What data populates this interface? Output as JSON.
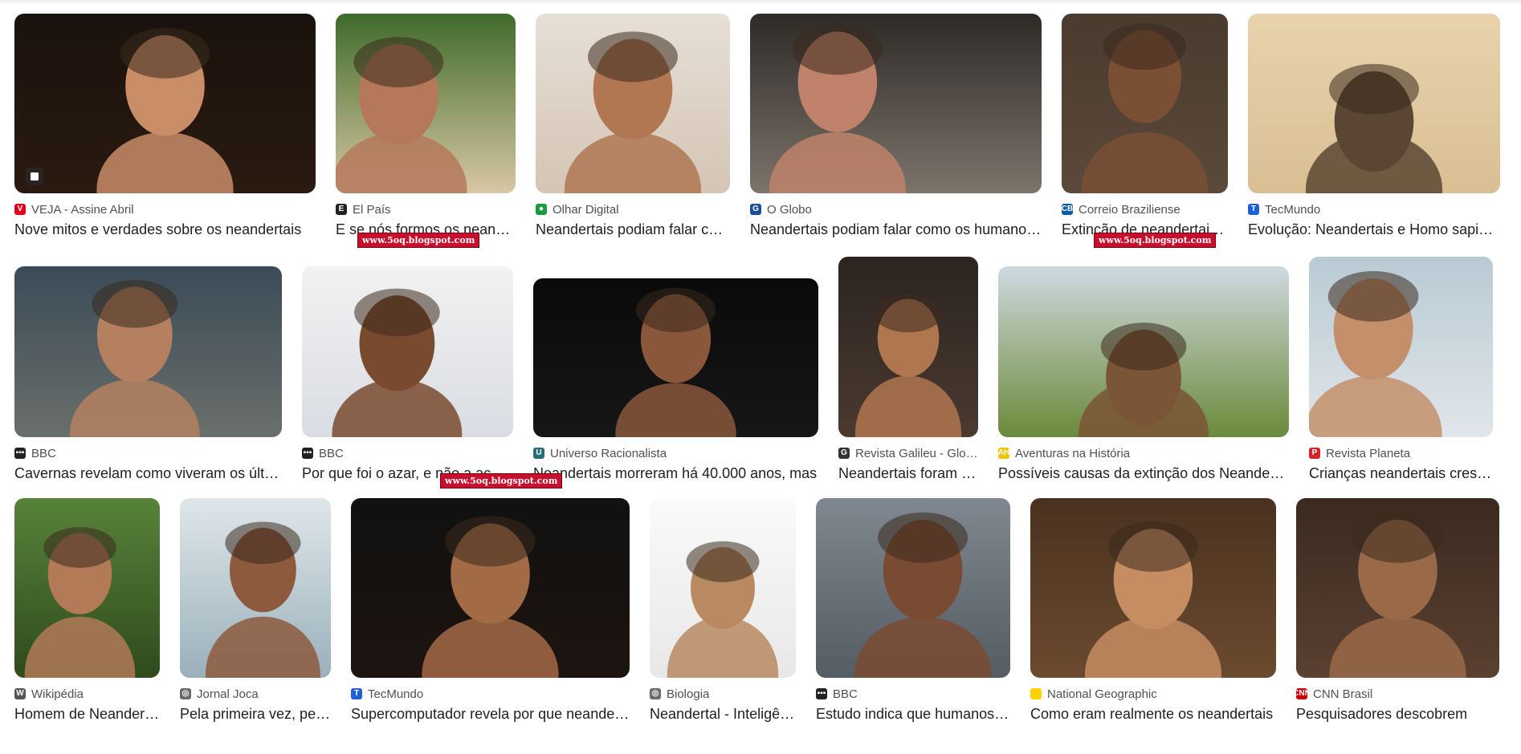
{
  "rows": [
    [
      {
        "source": "VEJA - Assine Abril",
        "title": "Nove mitos e verdades sobre os neandertais",
        "favicon": {
          "char": "V",
          "bg": "#e0001b"
        },
        "has_badge": true
      },
      {
        "source": "El País",
        "title": "E se nós formos os neandertais?",
        "favicon": {
          "char": "E",
          "bg": "#222222"
        }
      },
      {
        "source": "Olhar Digital",
        "title": "Neandertais podiam falar como os humanos",
        "favicon": {
          "char": "●",
          "bg": "#1a9c3e"
        }
      },
      {
        "source": "O Globo",
        "title": "Neandertais podiam falar como os humanos modernos",
        "favicon": {
          "char": "G",
          "bg": "#1b4f9c"
        }
      },
      {
        "source": "Correio Braziliense",
        "title": "Extinção de neandertais pode ter sido causada",
        "favicon": {
          "char": "CB",
          "bg": "#0d5aa7"
        }
      },
      {
        "source": "TecMundo",
        "title": "Evolução: Neandertais e Homo sapiens",
        "favicon": {
          "char": "T",
          "bg": "#1f5fd6"
        }
      }
    ],
    [
      {
        "source": "BBC",
        "title": "Cavernas revelam como viveram os últimos neandertais",
        "favicon": {
          "char": "▪▪▪",
          "bg": "#222222"
        }
      },
      {
        "source": "BBC",
        "title": "Por que foi o azar, e não a ação humana",
        "favicon": {
          "char": "▪▪▪",
          "bg": "#222222"
        },
        "watermark": "www.5oq.blogspot.com"
      },
      {
        "source": "Universo Racionalista",
        "title": "Neandertais morreram há 40.000 anos, mas",
        "favicon": {
          "char": "U",
          "bg": "#2a6d7a"
        }
      },
      {
        "source": "Revista Galileu - Globo",
        "title": "Neandertais foram extintos",
        "favicon": {
          "char": "G",
          "bg": "#333333"
        }
      },
      {
        "source": "Aventuras na História",
        "title": "Possíveis causas da extinção dos Neandertais",
        "favicon": {
          "char": "AH",
          "bg": "#f2c200"
        },
        "watermark": "www.5oq.blogspot.com"
      },
      {
        "source": "Revista Planeta",
        "title": "Crianças neandertais cresciam",
        "favicon": {
          "char": "P",
          "bg": "#d3222a"
        }
      }
    ],
    [
      {
        "source": "Wikipédia",
        "title": "Homem de Neandertal",
        "favicon": {
          "char": "W",
          "bg": "#555555"
        }
      },
      {
        "source": "Jornal Joca",
        "title": "Pela primeira vez, pesquisadores",
        "favicon": {
          "char": "◎",
          "bg": "#6b6b6b"
        }
      },
      {
        "source": "TecMundo",
        "title": "Supercomputador revela por que neandertais",
        "favicon": {
          "char": "T",
          "bg": "#1f5fd6"
        },
        "watermark": "www.5oq.blogspot.com"
      },
      {
        "source": "Biologia",
        "title": "Neandertal - Inteligência",
        "favicon": {
          "char": "◎",
          "bg": "#6b6b6b"
        }
      },
      {
        "source": "BBC",
        "title": "Estudo indica que humanos modernos",
        "favicon": {
          "char": "▪▪▪",
          "bg": "#222222"
        }
      },
      {
        "source": "National Geographic",
        "title": "Como eram realmente os neandertais",
        "favicon": {
          "char": "",
          "bg": "#ffd200"
        }
      },
      {
        "source": "CNN Brasil",
        "title": "Pesquisadores descobrem",
        "favicon": {
          "char": "CNN",
          "bg": "#cc0000"
        }
      }
    ]
  ]
}
